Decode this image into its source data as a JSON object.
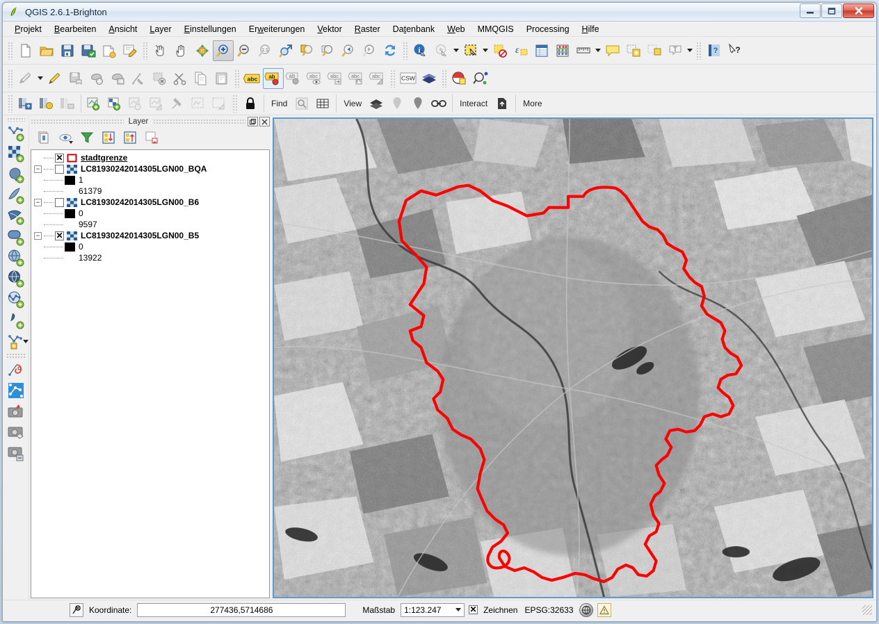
{
  "window": {
    "title": "QGIS 2.6.1-Brighton",
    "app_icon": "qgis-logo-icon",
    "minimize_label": "–",
    "maximize_label": "□",
    "close_label": "✕"
  },
  "menubar": {
    "items": [
      {
        "label": "Projekt",
        "mnemonic": "P"
      },
      {
        "label": "Bearbeiten",
        "mnemonic": "B"
      },
      {
        "label": "Ansicht",
        "mnemonic": "A"
      },
      {
        "label": "Layer",
        "mnemonic": "L"
      },
      {
        "label": "Einstellungen",
        "mnemonic": "E"
      },
      {
        "label": "Erweiterungen",
        "mnemonic": "w"
      },
      {
        "label": "Vektor",
        "mnemonic": "V"
      },
      {
        "label": "Raster",
        "mnemonic": "R"
      },
      {
        "label": "Datenbank",
        "mnemonic": "t"
      },
      {
        "label": "Web",
        "mnemonic": "W"
      },
      {
        "label": "MMQGIS",
        "mnemonic": ""
      },
      {
        "label": "Processing",
        "mnemonic": ""
      },
      {
        "label": "Hilfe",
        "mnemonic": "H"
      }
    ]
  },
  "toolbar_row1": {
    "buttons": [
      {
        "name": "new-project-icon",
        "title": "Neues Projekt"
      },
      {
        "name": "open-project-icon",
        "title": "Projekt öffnen"
      },
      {
        "name": "save-project-icon",
        "title": "Projekt speichern"
      },
      {
        "name": "save-project-as-icon",
        "title": "Projekt speichern unter"
      },
      {
        "name": "new-print-composer-icon",
        "title": "Neue Drucklayout"
      },
      {
        "name": "composer-manager-icon",
        "title": "Layoutverwaltung"
      },
      {
        "name": "touch-zoom-icon",
        "title": "Touch-Zoom und -Pan"
      },
      {
        "name": "pan-map-icon",
        "title": "Karte verschieben"
      },
      {
        "name": "pan-to-selection-icon",
        "title": "Karte auf Auswahl verschieben"
      },
      {
        "name": "zoom-in-icon",
        "title": "Hineinzoomen",
        "active": true
      },
      {
        "name": "zoom-out-icon",
        "title": "Herauszoomen"
      },
      {
        "name": "zoom-native-icon",
        "title": "Auf natürliche Auflösung zoomen (1:1)"
      },
      {
        "name": "zoom-full-icon",
        "title": "Volle Ausdehnung"
      },
      {
        "name": "zoom-to-selection-icon",
        "title": "Auf Auswahl zoomen"
      },
      {
        "name": "zoom-to-layer-icon",
        "title": "Auf Layer zoomen"
      },
      {
        "name": "zoom-last-icon",
        "title": "Letzter Zoom"
      },
      {
        "name": "zoom-next-icon",
        "title": "Nächster Zoom"
      },
      {
        "name": "refresh-icon",
        "title": "Aktualisieren"
      },
      {
        "name": "identify-features-icon",
        "title": "Objekte abfragen"
      },
      {
        "name": "run-feature-action-icon",
        "title": "Objektaktion ausführen"
      },
      {
        "name": "select-features-icon",
        "title": "Objekte wählen"
      },
      {
        "name": "deselect-features-icon",
        "title": "Auswahl aufheben"
      },
      {
        "name": "select-by-expression-icon",
        "title": "Mit Ausdruck wählen"
      },
      {
        "name": "open-attribute-table-icon",
        "title": "Attributtabelle öffnen"
      },
      {
        "name": "open-field-calculator-icon",
        "title": "Feldrechner"
      },
      {
        "name": "measure-line-icon",
        "title": "Linie messen"
      },
      {
        "name": "map-tips-icon",
        "title": "Kartenhinweise"
      },
      {
        "name": "new-bookmark-icon",
        "title": "Neues Lesezeichen"
      },
      {
        "name": "show-bookmarks-icon",
        "title": "Lesezeichen anzeigen"
      },
      {
        "name": "text-annotation-icon",
        "title": "Textanmerkung"
      },
      {
        "name": "help-contents-icon",
        "title": "Hilfeinhalt"
      },
      {
        "name": "whats-this-icon",
        "title": "Was ist das?"
      }
    ]
  },
  "toolbar_row2": {
    "buttons": [
      {
        "name": "current-edits-icon",
        "title": "Aktuelle Bearbeitungen"
      },
      {
        "name": "toggle-editing-icon",
        "title": "Bearbeitungsstatus umschalten"
      },
      {
        "name": "save-layer-edits-icon",
        "title": "Layeränderungen speichern"
      },
      {
        "name": "add-feature-icon",
        "title": "Objekt hinzufügen"
      },
      {
        "name": "move-feature-icon",
        "title": "Objekt verschieben"
      },
      {
        "name": "node-tool-icon",
        "title": "Knotenwerkzeug"
      },
      {
        "name": "delete-selected-icon",
        "title": "Ausgewählte löschen"
      },
      {
        "name": "cut-features-icon",
        "title": "Objekte ausschneiden"
      },
      {
        "name": "copy-features-icon",
        "title": "Objekte kopieren"
      },
      {
        "name": "paste-features-icon",
        "title": "Objekte einfügen"
      },
      {
        "name": "layer-labeling-icon",
        "title": "Layerbeschriftung",
        "chip": "abc"
      },
      {
        "name": "pin-labels-icon",
        "title": "Beschriftungen anheften",
        "chip": "ab",
        "selected": true
      },
      {
        "name": "highlight-labels-icon",
        "title": "Beschriftungen hervorheben",
        "chip": "ab"
      },
      {
        "name": "show-hide-labels-icon",
        "title": "Beschriftungen zeigen/verstecken",
        "chip": "abc"
      },
      {
        "name": "move-label-icon",
        "title": "Beschriftung verschieben",
        "chip": "abc"
      },
      {
        "name": "rotate-label-icon",
        "title": "Beschriftung drehen",
        "chip": "abc"
      },
      {
        "name": "change-label-icon",
        "title": "Beschriftung ändern",
        "chip": "abc"
      },
      {
        "name": "csw-catalog-icon",
        "title": "CSW Katalog",
        "chip": "CSW"
      },
      {
        "name": "openlayers-plugin-icon",
        "title": "OpenLayers-Erweiterung"
      },
      {
        "name": "georeferencer-icon",
        "title": "Georeferenzierer"
      },
      {
        "name": "metasearch-icon",
        "title": "MetaSearch"
      }
    ]
  },
  "toolbar_row3": {
    "buttons": [
      {
        "name": "raster-histogram-stretch-icon",
        "title": "Histogrammdehnung"
      },
      {
        "name": "raster-brightness-icon",
        "title": "Helligkeit"
      },
      {
        "name": "raster-local-stretch-icon",
        "title": "Lokale Dehnung"
      },
      {
        "name": "add-vector-node-icon",
        "title": "Vektor hinzufügen"
      },
      {
        "name": "add-raster-node-icon",
        "title": "Raster hinzufügen"
      },
      {
        "name": "node-settings-icon",
        "title": "Einstellungen"
      },
      {
        "name": "node-edit-icon",
        "title": "Bearbeiten"
      },
      {
        "name": "pin-tool-icon",
        "title": "Anheften"
      },
      {
        "name": "select-region-icon",
        "title": "Bereich wählen"
      },
      {
        "name": "edit-region-icon",
        "title": "Bereich bearbeiten"
      },
      {
        "name": "lock-icon",
        "title": "Sperren"
      }
    ],
    "groups": [
      {
        "label": "Find",
        "name": "find-group",
        "icons": [
          "find-search-icon",
          "find-grid-icon"
        ]
      },
      {
        "label": "View",
        "name": "view-group",
        "icons": [
          "view-layers-icon",
          "view-marker-faint-icon",
          "view-marker-icon",
          "view-link-icon"
        ]
      },
      {
        "label": "Interact",
        "name": "interact-group",
        "icons": [
          "interact-upload-icon"
        ]
      },
      {
        "label": "More",
        "name": "more-group",
        "icons": []
      }
    ]
  },
  "left_dock": {
    "buttons": [
      {
        "name": "add-vector-layer-icon",
        "title": "Vektorlayer hinzufügen"
      },
      {
        "name": "add-raster-layer-icon",
        "title": "Rasterlayer hinzufügen"
      },
      {
        "name": "add-postgis-layer-icon",
        "title": "PostGIS-Layer hinzufügen"
      },
      {
        "name": "add-spatialite-layer-icon",
        "title": "SpatiaLite-Layer hinzufügen"
      },
      {
        "name": "add-mssql-layer-icon",
        "title": "MSSQL-Layer hinzufügen"
      },
      {
        "name": "add-oracle-layer-icon",
        "title": "Oracle-Layer hinzufügen"
      },
      {
        "name": "add-wms-layer-icon",
        "title": "WMS/WMTS-Layer hinzufügen"
      },
      {
        "name": "add-wcs-layer-icon",
        "title": "WCS-Layer hinzufügen"
      },
      {
        "name": "add-wfs-layer-icon",
        "title": "WFS-Layer hinzufügen"
      },
      {
        "name": "add-delimited-text-layer-icon",
        "title": "Textdatei-Layer hinzufügen"
      },
      {
        "name": "new-layer-icon",
        "title": "Neuer Layer"
      },
      {
        "name": "new-memory-layer-icon",
        "title": "Temporärer Layer"
      },
      {
        "name": "open-attribute-table-dock-icon",
        "title": "Attributtabelle"
      },
      {
        "name": "add-photo-pin-icon",
        "title": "Foto anheften"
      },
      {
        "name": "photo-tag-icon",
        "title": "Foto markieren"
      },
      {
        "name": "photo-export-icon",
        "title": "Foto exportieren"
      }
    ]
  },
  "layer_panel": {
    "title": "Layer",
    "float_button": "⧉",
    "close_button": "✕",
    "toolbar": [
      {
        "name": "add-group-icon",
        "title": "Gruppe hinzufügen"
      },
      {
        "name": "manage-layer-visibility-icon",
        "title": "Layersichtbarkeit verwalten"
      },
      {
        "name": "filter-legend-icon",
        "title": "Legende filtern"
      },
      {
        "name": "expand-all-icon",
        "title": "Alles ausklappen"
      },
      {
        "name": "collapse-all-icon",
        "title": "Alles einklappen"
      },
      {
        "name": "remove-layer-icon",
        "title": "Layer/Gruppe entfernen"
      }
    ],
    "layers": [
      {
        "name": "stadtgrenze",
        "type": "vector",
        "checked": true,
        "selected": true,
        "expandable": false,
        "symbol": "red-outline-polygon",
        "children": []
      },
      {
        "name": "LC81930242014305LGN00_BQA",
        "type": "raster",
        "checked": false,
        "selected": false,
        "expandable": true,
        "expanded": true,
        "symbol": "raster-checker",
        "children": [
          {
            "swatch": "black",
            "label": "1"
          },
          {
            "swatch": "none",
            "label": "61379"
          }
        ]
      },
      {
        "name": "LC81930242014305LGN00_B6",
        "type": "raster",
        "checked": false,
        "selected": false,
        "expandable": true,
        "expanded": true,
        "symbol": "raster-checker",
        "children": [
          {
            "swatch": "black",
            "label": "0"
          },
          {
            "swatch": "none",
            "label": "9597"
          }
        ]
      },
      {
        "name": "LC81930242014305LGN00_B5",
        "type": "raster",
        "checked": true,
        "selected": false,
        "expandable": true,
        "expanded": true,
        "symbol": "raster-checker",
        "children": [
          {
            "swatch": "black",
            "label": "0"
          },
          {
            "swatch": "none",
            "label": "13922"
          }
        ]
      }
    ]
  },
  "map": {
    "boundary_color": "#ff0000",
    "boundary_label": "stadtgrenze",
    "canvas_border_color": "#5b9bd5",
    "basemap": "landsat-grayscale"
  },
  "statusbar": {
    "locator_icon": "coordinate-capture-icon",
    "coordinate_label": "Koordinate:",
    "coordinate_value": "277436,5714686",
    "scale_label": "Maßstab",
    "scale_value": "1:123.247",
    "render_checkbox_label": "Zeichnen",
    "render_checked": true,
    "crs_label": "EPSG:32633",
    "crs_button_icon": "crs-globe-icon",
    "messages_icon": "warning-icon"
  },
  "colors": {
    "accent_blue": "#5b9bd5",
    "boundary_red": "#ff0000",
    "title_blue": "#0b2744",
    "chrome_gray": "#f0f0f0",
    "label_yellow": "#ffdd55"
  }
}
